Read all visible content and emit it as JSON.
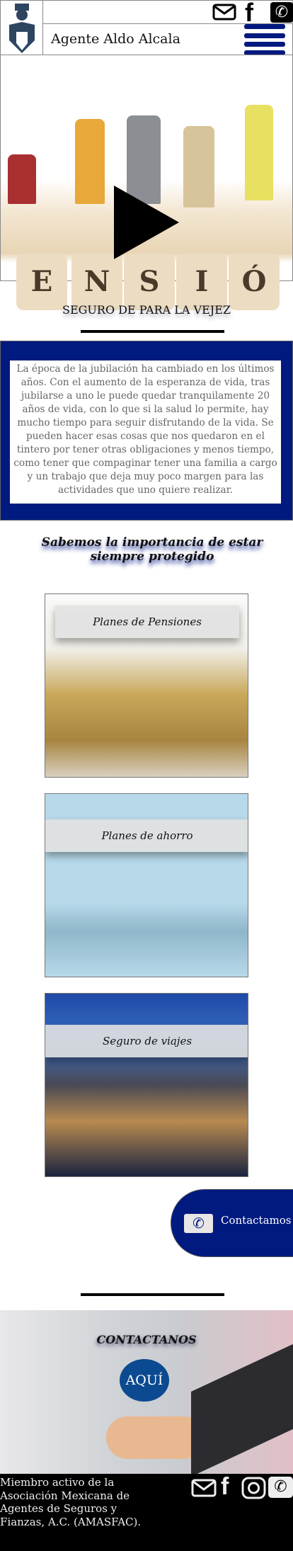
{
  "header": {
    "agent_name": "Agente Aldo Alcala",
    "icons": [
      "mail-icon",
      "facebook-icon",
      "phone-icon",
      "menu-icon"
    ]
  },
  "hero": {
    "blocks": [
      "E",
      "N",
      "S",
      "I",
      "Ó"
    ]
  },
  "section": {
    "title": "SEGURO DE PARA LA VEJEZ",
    "body": "La época de la jubilación ha cambiado en los últimos años. Con el aumento de la esperanza de vida, tras jubilarse a uno le puede quedar tranquilamente 20 años de vida, con lo que si la salud lo permite, hay mucho tiempo para seguir disfrutando de la vida. Se pueden hacer esas cosas que nos quedaron en el tintero por tener otras obligaciones y menos tiempo, como tener que compaginar tener una familia a cargo y un trabajo que deja muy poco margen para las actividades que uno quiere realizar.",
    "subtitle": "Sabemos la importancia de estar siempre protegido"
  },
  "cards": [
    {
      "label": "Planes de Pensiones"
    },
    {
      "label": "Planes de ahorro"
    },
    {
      "label": "Seguro de viajes"
    }
  ],
  "contact_button": {
    "label": "Contactamos"
  },
  "contact": {
    "title": "CONTACTANOS",
    "button": "AQUÍ"
  },
  "footer": {
    "text": "Miembro activo de la Asociación Mexicana de Agentes de Seguros y Fianzas, A.C. (AMASFAC).",
    "icons": [
      "mail-icon",
      "facebook-icon",
      "instagram-icon",
      "phone-icon"
    ]
  },
  "colors": {
    "brand": "#001a80",
    "aqui": "#0b4a90"
  }
}
